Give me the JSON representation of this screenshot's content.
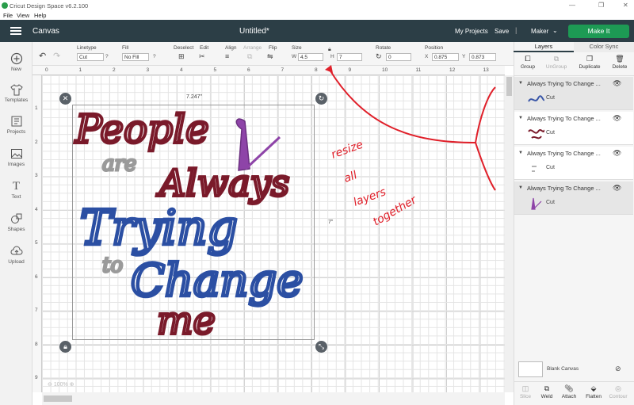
{
  "window": {
    "title": "Cricut Design Space  v6.2.100",
    "controls": [
      "—",
      "❐",
      "✕"
    ]
  },
  "menu": [
    "File",
    "View",
    "Help"
  ],
  "header": {
    "section": "Canvas",
    "document": "Untitled*",
    "my_projects": "My Projects",
    "save": "Save",
    "separator": "|",
    "machine": "Maker",
    "make_it": "Make It"
  },
  "sidebar": [
    {
      "label": "New",
      "icon": "plus-icon"
    },
    {
      "label": "Templates",
      "icon": "shirt-icon"
    },
    {
      "label": "Projects",
      "icon": "projects-icon"
    },
    {
      "label": "Images",
      "icon": "image-icon"
    },
    {
      "label": "Text",
      "icon": "text-icon"
    },
    {
      "label": "Shapes",
      "icon": "shapes-icon"
    },
    {
      "label": "Upload",
      "icon": "upload-icon"
    }
  ],
  "toolbar": {
    "linetype_label": "Linetype",
    "linetype_value": "Cut",
    "fill_label": "Fill",
    "fill_value": "No Fill",
    "deselect": "Deselect",
    "edit": "Edit",
    "align": "Align",
    "arrange": "Arrange",
    "flip": "Flip",
    "size_label": "Size",
    "w_label": "W",
    "w_value": "4.5",
    "h_label": "H",
    "h_value": "7",
    "rotate_label": "Rotate",
    "rotate_value": "0",
    "position_label": "Position",
    "x_label": "X",
    "x_value": "0.875",
    "y_label": "Y",
    "y_value": "0.873",
    "help": "?"
  },
  "ruler": {
    "h": [
      "0",
      "1",
      "2",
      "3",
      "4",
      "5",
      "6",
      "7",
      "8",
      "9",
      "10",
      "11",
      "12",
      "13"
    ],
    "v": [
      "1",
      "2",
      "3",
      "4",
      "5",
      "6",
      "7",
      "8",
      "9"
    ]
  },
  "canvas": {
    "width_label": "7.247\"",
    "height_label": "7\"",
    "zoom": "100%",
    "artwork": {
      "line1": "People",
      "line2": "are",
      "line3": "Always",
      "line4": "Trying",
      "line5": "to",
      "line6": "Change",
      "line7": "me"
    },
    "annotation": [
      "resize",
      "all",
      "layers",
      "together"
    ]
  },
  "panel": {
    "tabs": [
      "Layers",
      "Color Sync"
    ],
    "tools": [
      "Group",
      "UnGroup",
      "Duplicate",
      "Delete"
    ],
    "layers": [
      {
        "name": "Always Trying To Change ...",
        "op": "Cut",
        "color": "#3a57a8"
      },
      {
        "name": "Always Trying To Change ...",
        "op": "Cut",
        "color": "#7a1a2a"
      },
      {
        "name": "Always Trying To Change ...",
        "op": "Cut",
        "color": "#9a9a9a"
      },
      {
        "name": "Always Trying To Change ...",
        "op": "Cut",
        "color": "#8e44a8"
      }
    ],
    "blank_canvas": "Blank Canvas",
    "bottom_tools": [
      "Slice",
      "Weld",
      "Attach",
      "Flatten",
      "Contour"
    ]
  },
  "colors": {
    "header": "#2c3e46",
    "make_it": "#1d9a54",
    "maroon": "#7a1a2a",
    "blue": "#2b4fa3",
    "gray": "#9a9a9a",
    "purple": "#8e44a8",
    "annotation": "#e0202a"
  }
}
